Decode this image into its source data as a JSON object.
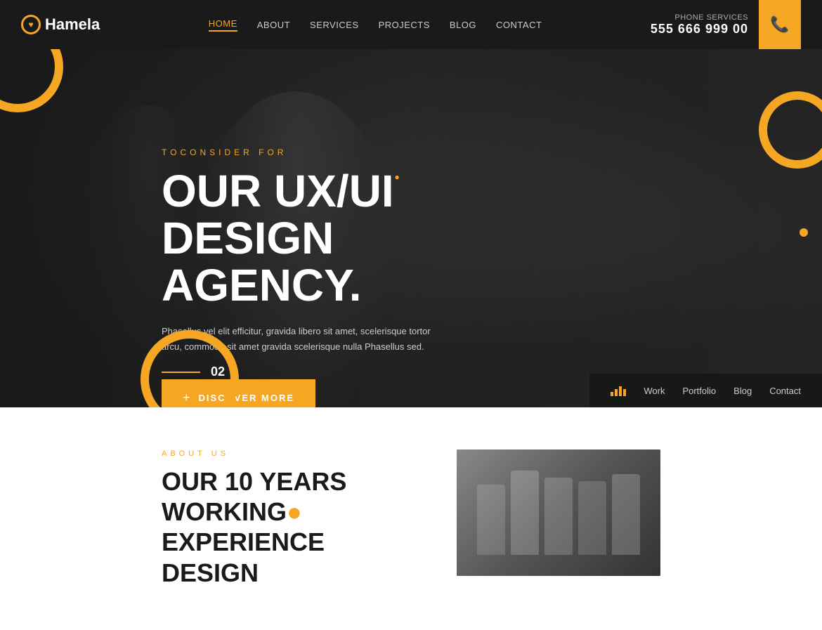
{
  "header": {
    "logo_text": "Hamela",
    "nav": [
      {
        "label": "HOME",
        "active": true,
        "id": "nav-home"
      },
      {
        "label": "ABOUT",
        "active": false,
        "id": "nav-about"
      },
      {
        "label": "SERVICES",
        "active": false,
        "id": "nav-services"
      },
      {
        "label": "PROJECTS",
        "active": false,
        "id": "nav-projects"
      },
      {
        "label": "BLOG",
        "active": false,
        "id": "nav-blog"
      },
      {
        "label": "CONTACT",
        "active": false,
        "id": "nav-contact"
      }
    ],
    "phone_label": "Phone Services",
    "phone_number": "555 666 999 00"
  },
  "hero": {
    "subtitle": "TOCONSIDER FOR",
    "title_line1": "OUR UX/UI",
    "title_line2": "DESIGN AGENCY.",
    "description": "Phasellus vel elit efficitur, gravida libero sit amet, scelerisque tortor arcu, commodo sit amet gravida scelerisque nulla Phasellus sed.",
    "cta_label": "DISCOVER MORE",
    "slide_number": "02",
    "bottom_nav": [
      {
        "label": "Work",
        "icon": true
      },
      {
        "label": "Portfolio"
      },
      {
        "label": "Blog"
      },
      {
        "label": "Contact"
      }
    ]
  },
  "below_fold": {
    "about_label": "ABOUT US",
    "about_title_line1": "OUR 10 YEARS WORKING",
    "about_title_line2": "EXPERIENCE DESIGN"
  },
  "colors": {
    "accent": "#f5a623",
    "dark": "#1a1a1a",
    "text_light": "#cccccc"
  }
}
